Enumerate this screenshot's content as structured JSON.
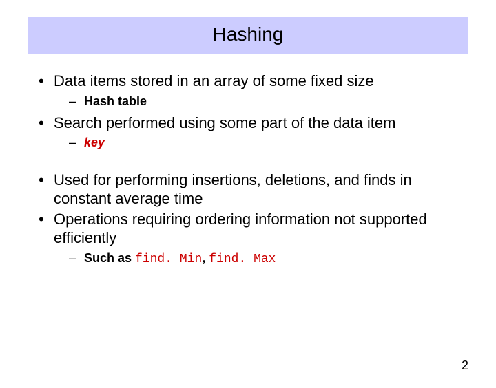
{
  "title": "Hashing",
  "bullets": {
    "b1": "Data items stored in an array of some fixed size",
    "b1_sub": "Hash table",
    "b2": "Search performed using some part of the data item",
    "b2_sub": "key",
    "b3": "Used for performing insertions, deletions, and finds in constant average time",
    "b4": "Operations requiring ordering information not supported efficiently",
    "b4_sub_prefix": "Such as ",
    "b4_code1": "find. Min",
    "b4_sep": ", ",
    "b4_code2": "find. Max"
  },
  "page_number": "2"
}
